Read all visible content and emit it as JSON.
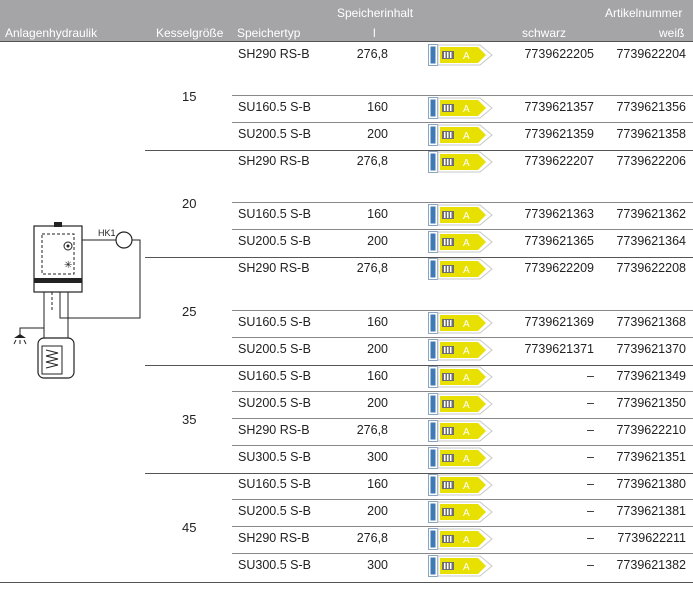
{
  "header": {
    "row1_storage_content": "Speicherinhalt",
    "row1_article_number": "Artikelnummer",
    "col_hydraulics": "Anlagenhydraulik",
    "col_boiler_size": "Kesselgröße",
    "col_tank_type": "Speichertyp",
    "col_content_unit": "l",
    "col_black": "schwarz",
    "col_white": "weiß"
  },
  "diagram": {
    "circuit_label": "HK1"
  },
  "energy_class": "A",
  "groups": [
    {
      "boiler": "15",
      "rows": [
        {
          "type": "SH290 RS-B",
          "volume": "276,8",
          "black": "7739622205",
          "white": "7739622204"
        },
        {
          "type": "SU160.5 S-B",
          "volume": "160",
          "black": "7739621357",
          "white": "7739621356"
        },
        {
          "type": "SU200.5 S-B",
          "volume": "200",
          "black": "7739621359",
          "white": "7739621358"
        }
      ]
    },
    {
      "boiler": "20",
      "rows": [
        {
          "type": "SH290 RS-B",
          "volume": "276,8",
          "black": "7739622207",
          "white": "7739622206"
        },
        {
          "type": "SU160.5 S-B",
          "volume": "160",
          "black": "7739621363",
          "white": "7739621362"
        },
        {
          "type": "SU200.5 S-B",
          "volume": "200",
          "black": "7739621365",
          "white": "7739621364"
        }
      ]
    },
    {
      "boiler": "25",
      "rows": [
        {
          "type": "SH290 RS-B",
          "volume": "276,8",
          "black": "7739622209",
          "white": "7739622208"
        },
        {
          "type": "SU160.5 S-B",
          "volume": "160",
          "black": "7739621369",
          "white": "7739621368"
        },
        {
          "type": "SU200.5 S-B",
          "volume": "200",
          "black": "7739621371",
          "white": "7739621370"
        }
      ]
    },
    {
      "boiler": "35",
      "rows": [
        {
          "type": "SU160.5 S-B",
          "volume": "160",
          "black": "–",
          "white": "7739621349"
        },
        {
          "type": "SU200.5 S-B",
          "volume": "200",
          "black": "–",
          "white": "7739621350"
        },
        {
          "type": "SH290 RS-B",
          "volume": "276,8",
          "black": "–",
          "white": "7739622210"
        },
        {
          "type": "SU300.5 S-B",
          "volume": "300",
          "black": "–",
          "white": "7739621351"
        }
      ]
    },
    {
      "boiler": "45",
      "rows": [
        {
          "type": "SU160.5 S-B",
          "volume": "160",
          "black": "–",
          "white": "7739621380"
        },
        {
          "type": "SU200.5 S-B",
          "volume": "200",
          "black": "–",
          "white": "7739621381"
        },
        {
          "type": "SH290 RS-B",
          "volume": "276,8",
          "black": "–",
          "white": "7739622211"
        },
        {
          "type": "SU300.5 S-B",
          "volume": "300",
          "black": "–",
          "white": "7739621382"
        }
      ]
    }
  ]
}
